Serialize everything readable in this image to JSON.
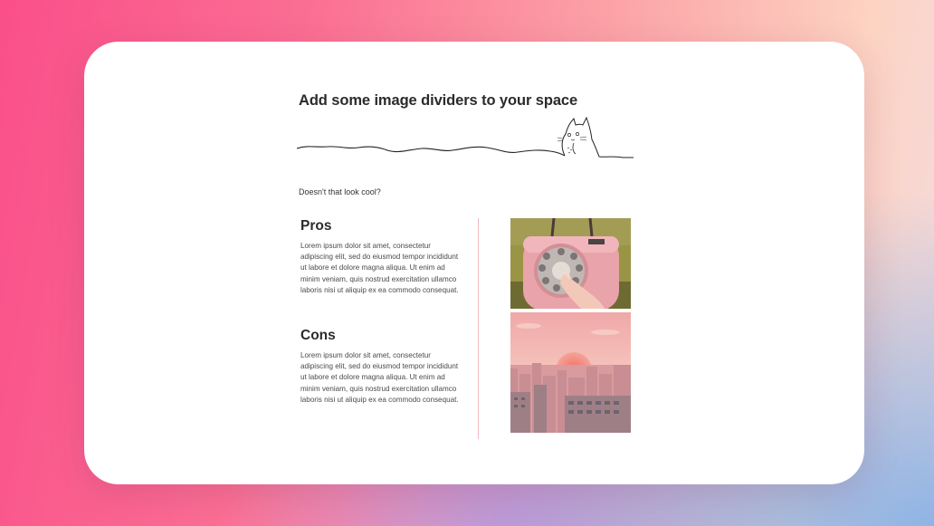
{
  "page": {
    "title": "Add some image dividers to your space",
    "caption": "Doesn't that look cool?"
  },
  "pros": {
    "heading": "Pros",
    "text": "Lorem ipsum dolor sit amet, consectetur adipiscing elit, sed do eiusmod tempor incididunt ut labore et dolore magna aliqua. Ut enim ad minim veniam, quis nostrud exercitation ullamco laboris nisi ut aliquip ex ea commodo consequat."
  },
  "cons": {
    "heading": "Cons",
    "text": "Lorem ipsum dolor sit amet, consectetur adipiscing elit, sed do eiusmod tempor incididunt ut labore et dolore magna aliqua. Ut enim ad minim veniam, quis nostrud exercitation ullamco laboris nisi ut aliquip ex ea commodo consequat."
  },
  "colors": {
    "accent_pink": "#fa4f8a",
    "divider_line": "#f3b8c3",
    "text_dark": "#2b2b2b"
  },
  "images": {
    "divider": "totoro-line-divider-icon",
    "top": "rotary-phone-image",
    "bottom": "pink-city-sunset-image"
  }
}
